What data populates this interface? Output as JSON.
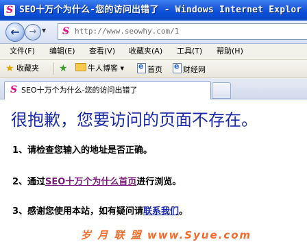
{
  "window": {
    "title": "SEO十万个为什么-您的访问出错了 - Windows Internet Explor",
    "icon": "ie-site-icon"
  },
  "nav": {
    "back_label": "←",
    "forward_label": "→",
    "url": "http://www.seowhy.com/1"
  },
  "menu": {
    "items": [
      "文件(F)",
      "编辑(E)",
      "查看(V)",
      "收藏夹(A)",
      "工具(T)",
      "帮助(H)"
    ]
  },
  "favorites": {
    "favorites_label": "收藏夹",
    "items": [
      "牛人博客 ▾",
      "首页",
      "财经网"
    ]
  },
  "tab": {
    "title": "SEO十万个为什么-您的访问出错了"
  },
  "content": {
    "heading": "很抱歉，您要访问的页面不存在。",
    "line1": "1、请检查您输入的地址是否正确。",
    "line2_prefix": "2、通过",
    "line2_link": "SEO十万个为什么首页",
    "line2_suffix": "进行浏览。",
    "line3_prefix": "3、感谢您使用本站，如有疑问请",
    "line3_link": "联系我们",
    "line3_suffix": "。"
  },
  "watermark": {
    "text": "岁 月 联 盟   www.Syue.com"
  },
  "colors": {
    "titlebar": "#0a4fd8",
    "heading": "#1a2aa8",
    "visited_link": "#7a1a7a",
    "watermark": "#f26b2a"
  }
}
